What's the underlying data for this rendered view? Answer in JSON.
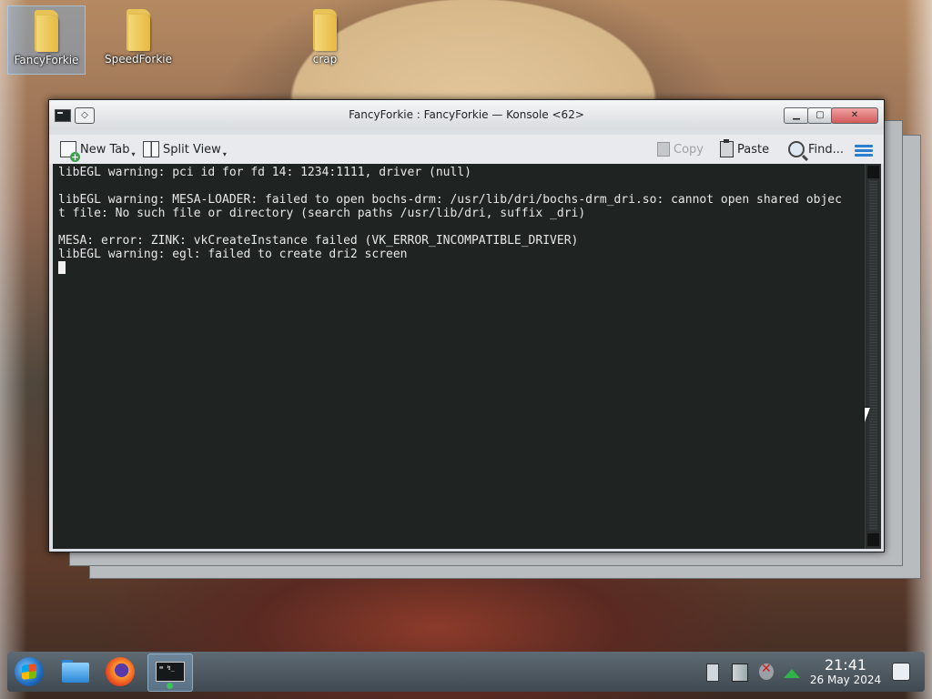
{
  "desktop": {
    "icons": [
      {
        "label": "FancyForkie"
      },
      {
        "label": "SpeedForkie"
      },
      {
        "label": "crap"
      }
    ]
  },
  "window": {
    "title": "FancyForkie : FancyForkie — Konsole <62>",
    "pin_glyph": "◇",
    "min_glyph": "▁",
    "max_glyph": "▢",
    "close_glyph": "✕"
  },
  "toolbar": {
    "new_tab": "New Tab",
    "split_view": "Split View",
    "copy": "Copy",
    "paste": "Paste",
    "find": "Find...",
    "dropdown_glyph": "▾"
  },
  "terminal": {
    "lines": [
      "libEGL warning: pci id for fd 14: 1234:1111, driver (null)",
      "",
      "libEGL warning: MESA-LOADER: failed to open bochs-drm: /usr/lib/dri/bochs-drm_dri.so: cannot open shared objec",
      "t file: No such file or directory (search paths /usr/lib/dri, suffix _dri)",
      "",
      "MESA: error: ZINK: vkCreateInstance failed (VK_ERROR_INCOMPATIBLE_DRIVER)",
      "libEGL warning: egl: failed to create dri2 screen"
    ]
  },
  "taskbar": {
    "konsole_label": "⌨ ↯_",
    "clock_time": "21:41",
    "clock_date": "26 May 2024"
  }
}
